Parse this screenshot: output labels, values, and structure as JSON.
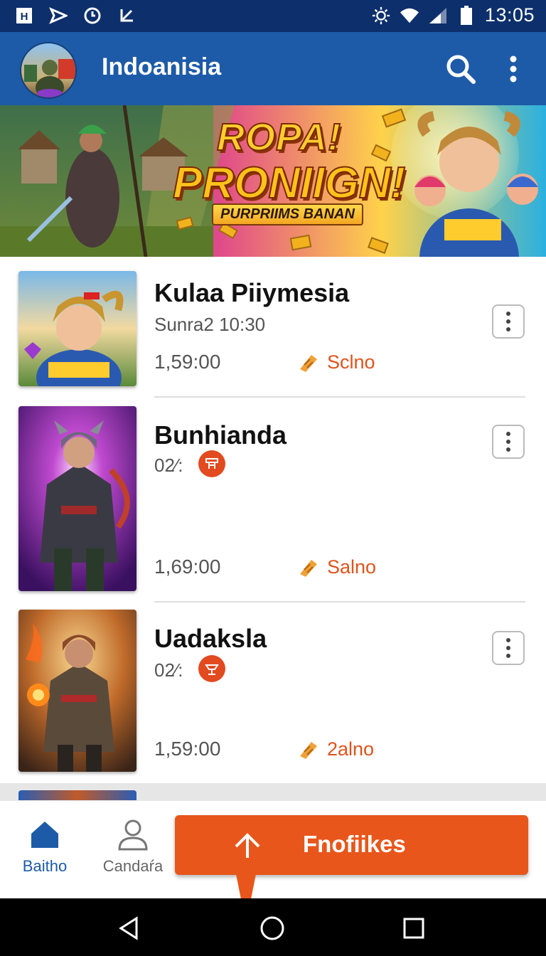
{
  "status_bar": {
    "time": "13:05",
    "left_icons": [
      "notification-h-icon",
      "send-icon",
      "clock-icon",
      "download-icon"
    ],
    "right_icons": [
      "brightness-icon",
      "wifi-icon",
      "signal-icon",
      "battery-icon"
    ]
  },
  "app_bar": {
    "title": "Indoanisia",
    "actions": [
      "search-icon",
      "more-vert-icon"
    ],
    "color": "#1d5ba8"
  },
  "banner": {
    "title_line1": "ROPA!",
    "title_line2": "PRONIIGN!",
    "subtitle": "PURPRIIMS BANAN"
  },
  "items": [
    {
      "title": "Kulaa Piiymesia",
      "subtitle": "Sunra2 10:30",
      "time": "1,59:00",
      "status": "Sclno"
    },
    {
      "title": "Bunhianda",
      "subtitle": "02⁄:",
      "time": "1,69:00",
      "status": "Salno"
    },
    {
      "title": "Uadaksla",
      "subtitle": "02⁄:",
      "time": "1,59:00",
      "status": "2alno"
    }
  ],
  "bottom_nav": {
    "home_label": "Baitho",
    "profile_label": "Candaŕa",
    "fab_label": "Fnofiikes",
    "accent": "#e8561b",
    "active_color": "#1d5ba8"
  }
}
